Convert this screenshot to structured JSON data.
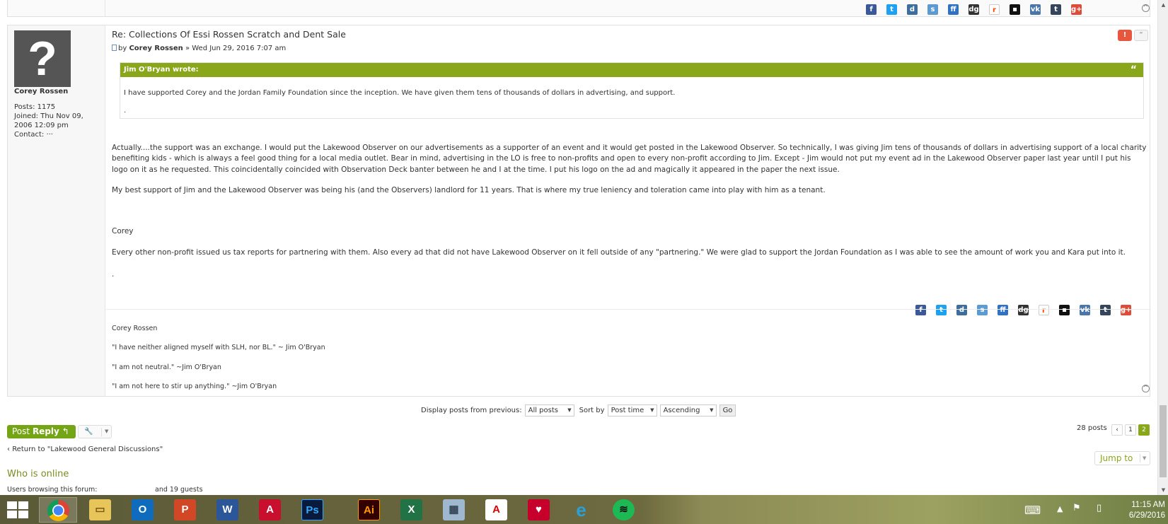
{
  "post": {
    "title": "Re: Collections Of Essi Rossen Scratch and Dent Sale",
    "by_prefix": "by",
    "author": "Corey Rossen",
    "date": "» Wed Jun 29, 2016 7:07 am",
    "profile": {
      "name": "Corey Rossen",
      "posts": "Posts: 1175",
      "joined": "Joined: Thu Nov 09, 2006 12:09 pm",
      "contact": "Contact: ···"
    },
    "quote": {
      "header": "Jim O'Bryan wrote:",
      "text": "I have supported Corey and the Jordan Family Foundation since the inception. We have given them tens of thousands of dollars in advertising, and support.",
      "dot": "."
    },
    "paragraphs": [
      "Actually....the support was an exchange. I would put the Lakewood Observer on our advertisements as a supporter of an event and it would get posted in the Lakewood Observer. So technically, I was giving Jim tens of thousands of dollars in advertising support of a local charity benefiting kids - which is always a feel good thing for a local media outlet. Bear in mind, advertising in the LO is free to non-profits and open to every non-profit according to Jim. Except - Jim would not put my event ad in the Lakewood Observer paper last year until I put his logo on it as he requested. This coincidentally coincided with Observation Deck banter between he and I at the time. I put his logo on the ad and magically it appeared in the paper the next issue.",
      "My best support of Jim and the Lakewood Observer was being his (and the Observers) landlord for 11 years. That is where my true leniency and toleration came into play with him as a tenant.",
      "Corey",
      "Every other non-profit issued us tax reports for partnering with them. Also every ad that did not have Lakewood Observer on it fell outside of any \"partnering.\" We were glad to support the Jordan Foundation as I was able to see the amount of work you and Kara put into it.",
      "."
    ],
    "signature": [
      "Corey Rossen",
      "\"I have neither aligned myself with SLH, nor BL.\" ~ Jim O'Bryan",
      "\"I am not neutral.\" ~Jim O'Bryan",
      "\"I am not here to stir up anything.\" ~Jim O'Bryan"
    ]
  },
  "share_icons": [
    "facebook-icon",
    "twitter-icon",
    "delicious-icon",
    "stumbleupon-icon",
    "friendfeed-icon",
    "digg-icon",
    "reddit-icon",
    "delicious2-icon",
    "vk-icon",
    "tumblr-icon",
    "google-plus-icon"
  ],
  "sort": {
    "display_label": "Display posts from previous:",
    "display_value": "All posts",
    "sort_label": "Sort by",
    "sort_value": "Post time",
    "order_value": "Ascending",
    "go_label": "Go"
  },
  "actions": {
    "reply_label_1": "Post",
    "reply_label_2": "Reply",
    "return_link": "Return to \"Lakewood General Discussions\"",
    "jump_to": "Jump to"
  },
  "pagination": {
    "count": "28 posts",
    "pages": [
      "1",
      "2"
    ],
    "current": "2"
  },
  "online": {
    "heading": "Who is online",
    "browsing": "Users browsing this forum:",
    "guests": "and 19 guests"
  },
  "taskbar": {
    "apps": [
      "chrome",
      "file-explorer",
      "outlook",
      "powerpoint",
      "word",
      "acrobat",
      "photoshop",
      "illustrator",
      "excel",
      "calculator",
      "pdf-reader",
      "iheartradio",
      "internet-explorer",
      "spotify"
    ],
    "time": "11:15 AM",
    "date": "6/29/2016"
  },
  "colors": {
    "accent": "#8aa61b",
    "reply": "#74a515",
    "report": "#e8573d"
  }
}
